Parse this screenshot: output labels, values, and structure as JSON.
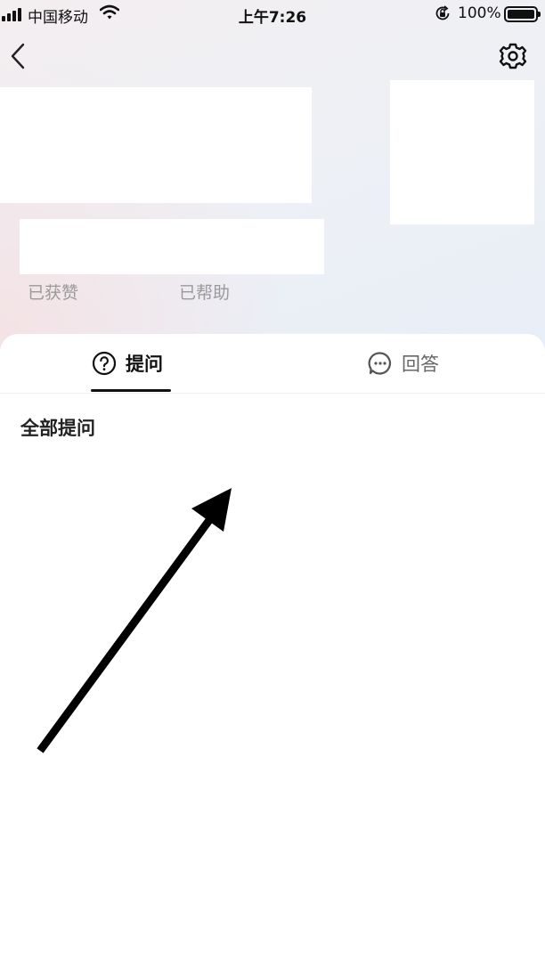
{
  "status_bar": {
    "carrier": "中国移动",
    "time": "上午7:26",
    "battery_percent": "100%",
    "icons": [
      "signal-icon",
      "wifi-icon",
      "orientation-lock-icon",
      "battery-icon"
    ]
  },
  "nav": {
    "back_icon": "chevron-left-icon",
    "settings_icon": "gear-icon"
  },
  "profile": {
    "stats": {
      "liked_label": "已获赞",
      "helped_label": "已帮助"
    }
  },
  "tabs": [
    {
      "label": "提问",
      "icon": "question-circle-icon",
      "active": true
    },
    {
      "label": "回答",
      "icon": "chat-bubble-icon",
      "active": false
    }
  ],
  "section": {
    "title": "全部提问"
  },
  "colors": {
    "active_tab": "#111111",
    "inactive_tab": "#666666",
    "stat_label": "#9a9a9a"
  }
}
